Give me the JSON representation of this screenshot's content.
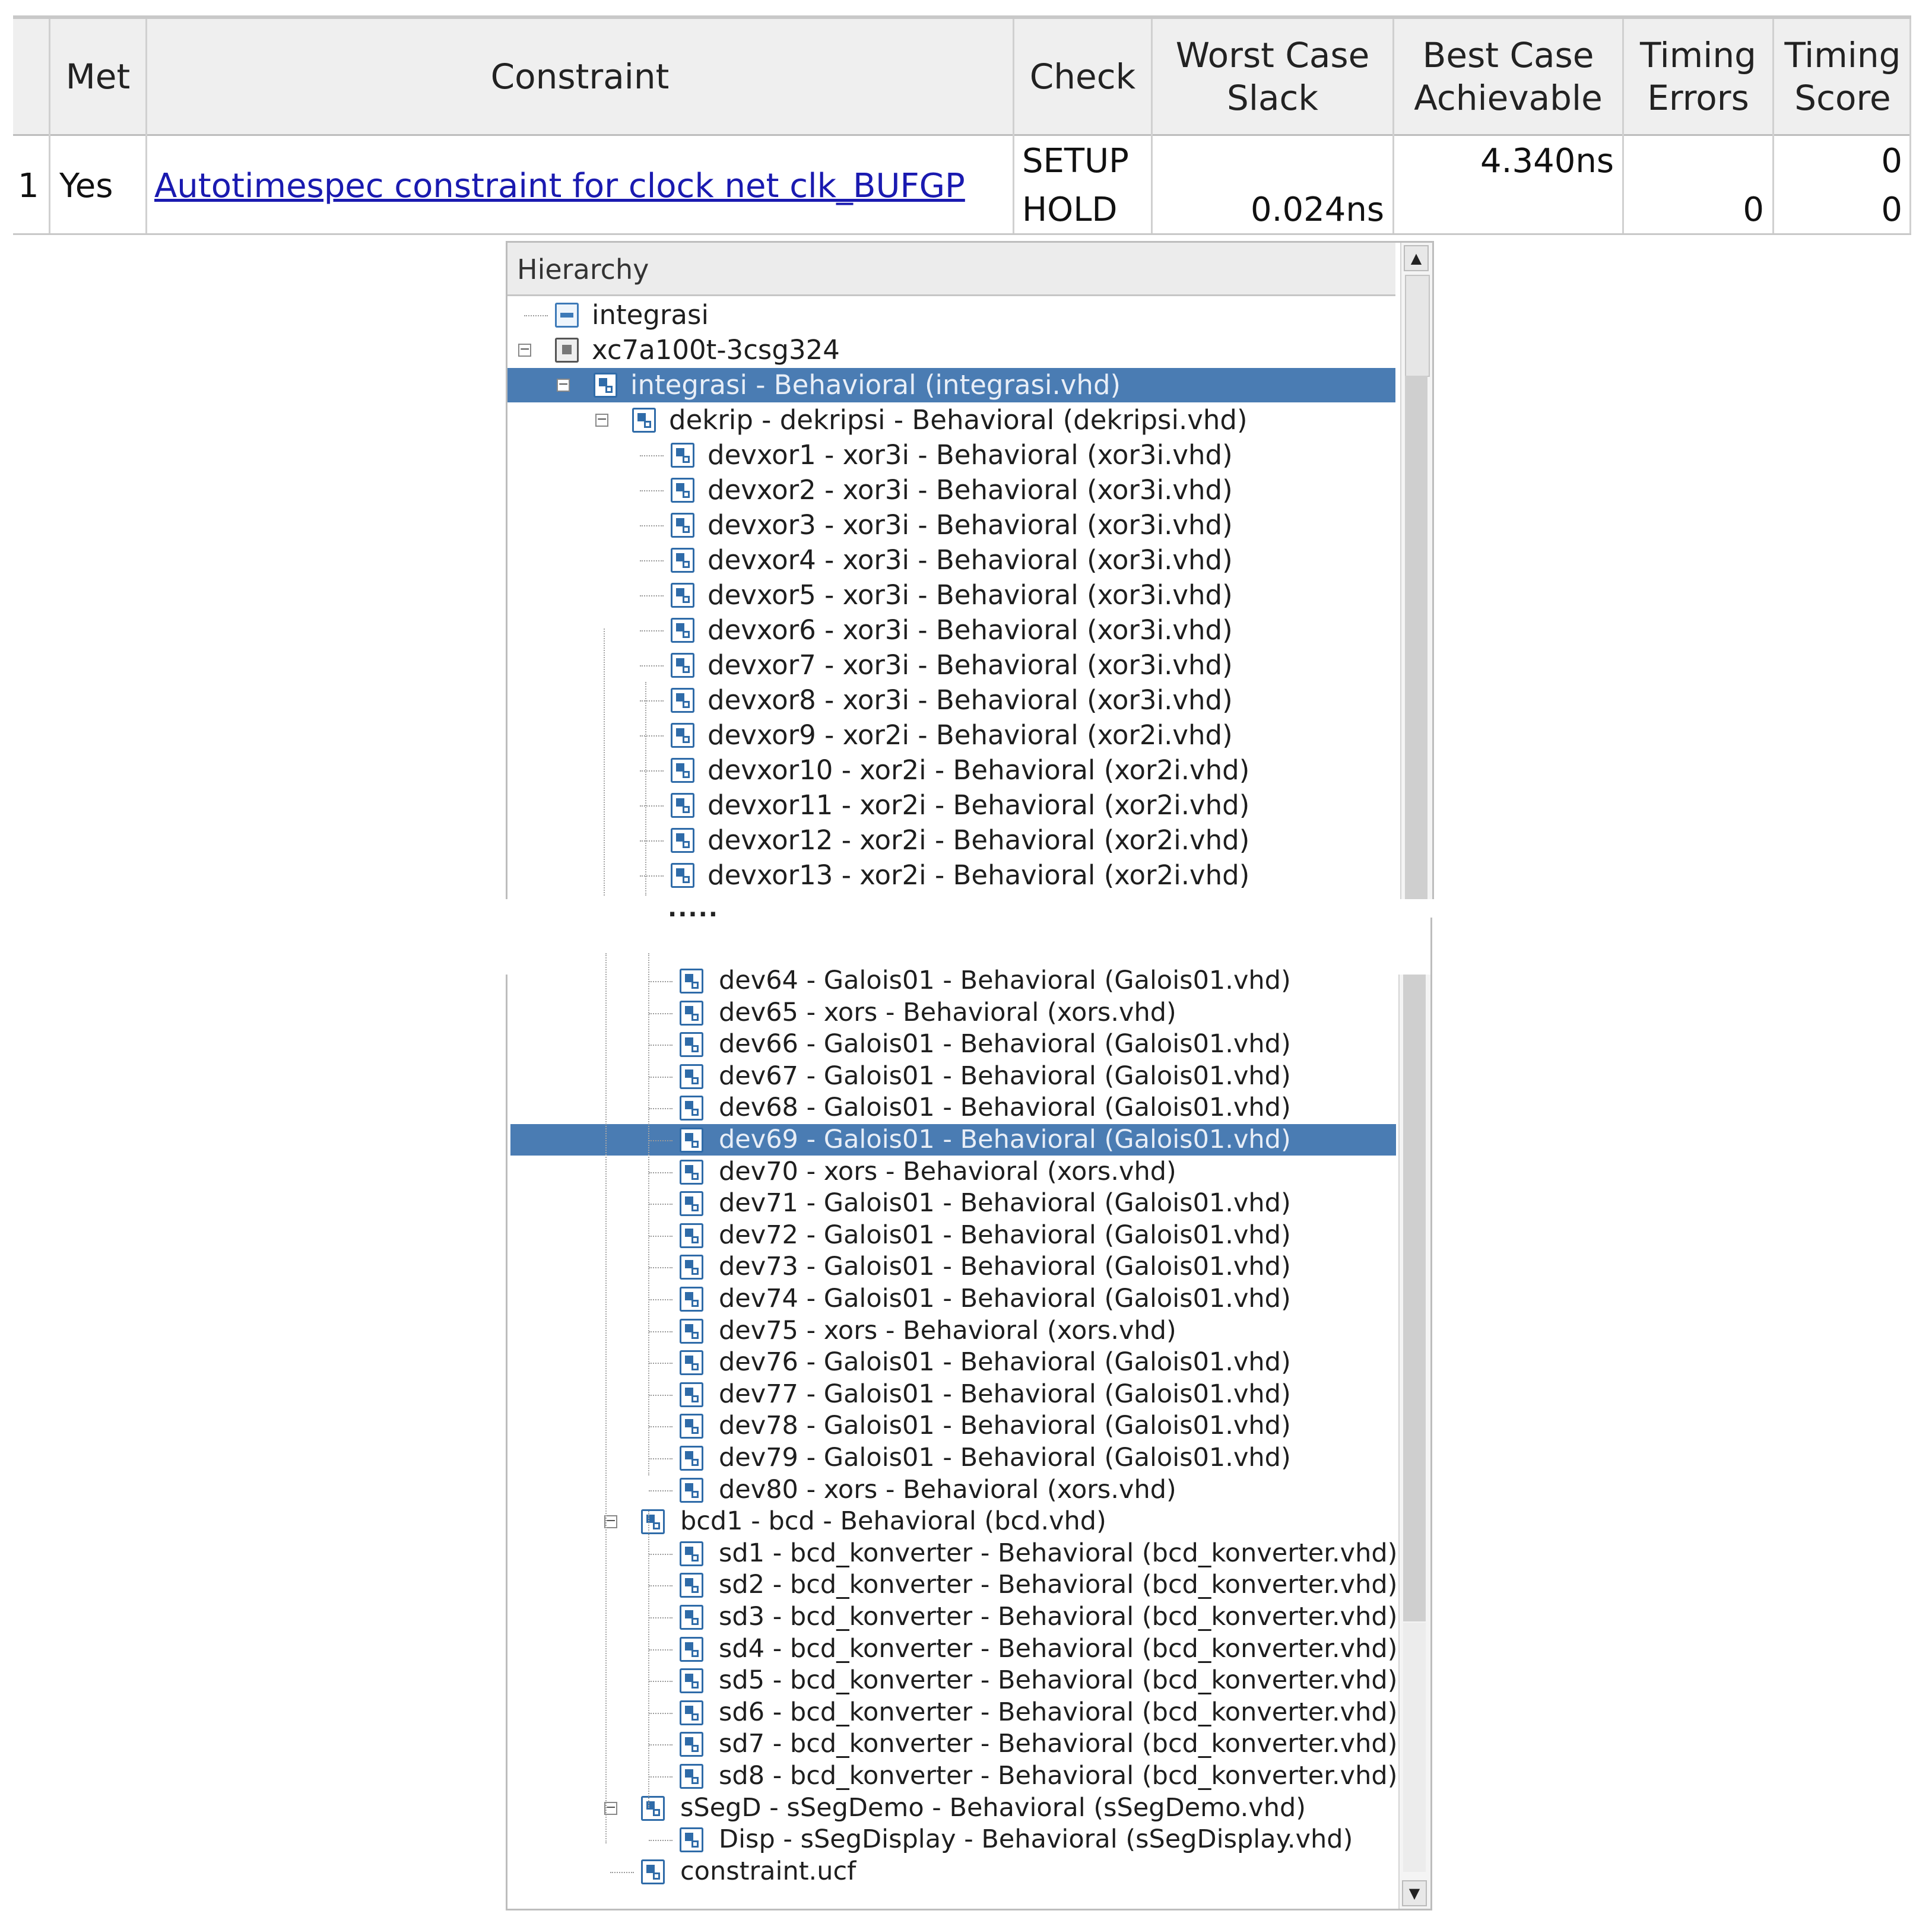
{
  "timing_table": {
    "headers": {
      "index": "",
      "met": "Met",
      "constraint": "Constraint",
      "check": "Check",
      "worst_case_slack": "Worst Case\nSlack",
      "best_case_achievable": "Best Case\nAchievable",
      "timing_errors": "Timing\nErrors",
      "timing_score": "Timing\nScore"
    },
    "row": {
      "index": "1",
      "met": "Yes",
      "constraint": "Autotimespec constraint for clock net clk_BUFGP",
      "check_setup": "SETUP",
      "check_hold": "HOLD",
      "worst_case_slack_setup": "",
      "worst_case_slack_hold": "0.024ns",
      "best_case_achievable_setup": "4.340ns",
      "best_case_achievable_hold": "",
      "timing_errors_setup": "",
      "timing_errors_hold": "0",
      "timing_score_setup": "0",
      "timing_score_hold": "0"
    }
  },
  "hierarchy": {
    "title": "Hierarchy",
    "top_items": [
      "integrasi",
      "xc7a100t-3csg324",
      "integrasi - Behavioral (integrasi.vhd)",
      "dekrip - dekripsi - Behavioral (dekripsi.vhd)",
      "devxor1 - xor3i - Behavioral (xor3i.vhd)",
      "devxor2 - xor3i - Behavioral (xor3i.vhd)",
      "devxor3 - xor3i - Behavioral (xor3i.vhd)",
      "devxor4 - xor3i - Behavioral (xor3i.vhd)",
      "devxor5 - xor3i - Behavioral (xor3i.vhd)",
      "devxor6 - xor3i - Behavioral (xor3i.vhd)",
      "devxor7 - xor3i - Behavioral (xor3i.vhd)",
      "devxor8 - xor3i - Behavioral (xor3i.vhd)",
      "devxor9 - xor2i - Behavioral (xor2i.vhd)",
      "devxor10 - xor2i - Behavioral (xor2i.vhd)",
      "devxor11 - xor2i - Behavioral (xor2i.vhd)",
      "devxor12 - xor2i - Behavioral (xor2i.vhd)",
      "devxor13 - xor2i - Behavioral (xor2i.vhd)"
    ],
    "ellipsis": [
      "·····",
      "·····"
    ],
    "bottom_items": [
      "dev64 - Galois01 - Behavioral (Galois01.vhd)",
      "dev65 - xors - Behavioral (xors.vhd)",
      "dev66 - Galois01 - Behavioral (Galois01.vhd)",
      "dev67 - Galois01 - Behavioral (Galois01.vhd)",
      "dev68 - Galois01 - Behavioral (Galois01.vhd)",
      "dev69 - Galois01 - Behavioral (Galois01.vhd)",
      "dev70 - xors - Behavioral (xors.vhd)",
      "dev71 - Galois01 - Behavioral (Galois01.vhd)",
      "dev72 - Galois01 - Behavioral (Galois01.vhd)",
      "dev73 - Galois01 - Behavioral (Galois01.vhd)",
      "dev74 - Galois01 - Behavioral (Galois01.vhd)",
      "dev75 - xors - Behavioral (xors.vhd)",
      "dev76 - Galois01 - Behavioral (Galois01.vhd)",
      "dev77 - Galois01 - Behavioral (Galois01.vhd)",
      "dev78 - Galois01 - Behavioral (Galois01.vhd)",
      "dev79 - Galois01 - Behavioral (Galois01.vhd)",
      "dev80 - xors - Behavioral (xors.vhd)",
      "bcd1 - bcd - Behavioral (bcd.vhd)",
      "sd1 - bcd_konverter - Behavioral (bcd_konverter.vhd)",
      "sd2 - bcd_konverter - Behavioral (bcd_konverter.vhd)",
      "sd3 - bcd_konverter - Behavioral (bcd_konverter.vhd)",
      "sd4 - bcd_konverter - Behavioral (bcd_konverter.vhd)",
      "sd5 - bcd_konverter - Behavioral (bcd_konverter.vhd)",
      "sd6 - bcd_konverter - Behavioral (bcd_konverter.vhd)",
      "sd7 - bcd_konverter - Behavioral (bcd_konverter.vhd)",
      "sd8 - bcd_konverter - Behavioral (bcd_konverter.vhd)",
      "sSegD - sSegDemo - Behavioral (sSegDemo.vhd)",
      "Disp - sSegDisplay - Behavioral (sSegDisplay.vhd)",
      "constraint.ucf"
    ],
    "selected": [
      "integrasi - Behavioral (integrasi.vhd)",
      "dev69 - Galois01 - Behavioral (Galois01.vhd)"
    ],
    "colors": {
      "selection": "#4a7cb3",
      "link": "#1a1ab0",
      "icon": "#2f6ba8"
    },
    "icons": {
      "file": "vhdl-file-icon",
      "chip": "device-chip-icon",
      "top": "top-module-icon"
    },
    "scroll_up": "▲",
    "scroll_down": "▼"
  }
}
